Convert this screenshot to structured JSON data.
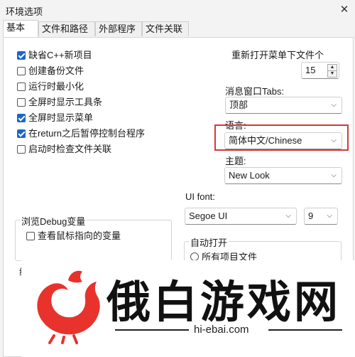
{
  "window": {
    "title": "环境选项",
    "close_glyph": "✕"
  },
  "tabs": [
    "基本",
    "文件和路径",
    "外部程序",
    "文件关联"
  ],
  "checkboxes": [
    {
      "label": "缺省C++新项目",
      "checked": true
    },
    {
      "label": "创建备份文件",
      "checked": false
    },
    {
      "label": "运行时最小化",
      "checked": false
    },
    {
      "label": "全屏时显示工具条",
      "checked": false
    },
    {
      "label": "全屏时显示菜单",
      "checked": true
    },
    {
      "label": "在return之后暂停控制台程序",
      "checked": true
    },
    {
      "label": "启动时检查文件关联",
      "checked": false
    }
  ],
  "reopen": {
    "label": "重新打开菜单下文件个",
    "value": "15"
  },
  "message_tabs": {
    "label": "消息窗口Tabs:",
    "value": "顶部"
  },
  "language": {
    "label": "语言:",
    "value": "简体中文/Chinese"
  },
  "theme": {
    "label": "主题:",
    "value": "New Look"
  },
  "ui_font": {
    "label": "UI font:",
    "family": "Segoe UI",
    "size": "9"
  },
  "debug_group": {
    "title": "浏览Debug变量",
    "checkbox_label": "查看鼠标指向的变量",
    "checked": false
  },
  "autoopen_group": {
    "title": "自动打开",
    "radio_label": "所有项目文件"
  },
  "partial_glyph": "编",
  "watermark": {
    "brand": "俄白游戏网",
    "url": "hi-ebai.com",
    "logo": "rooster-logo"
  },
  "colors": {
    "accent": "#1a66c9",
    "highlight": "#d43a3a",
    "logo_red": "#e8322c"
  }
}
